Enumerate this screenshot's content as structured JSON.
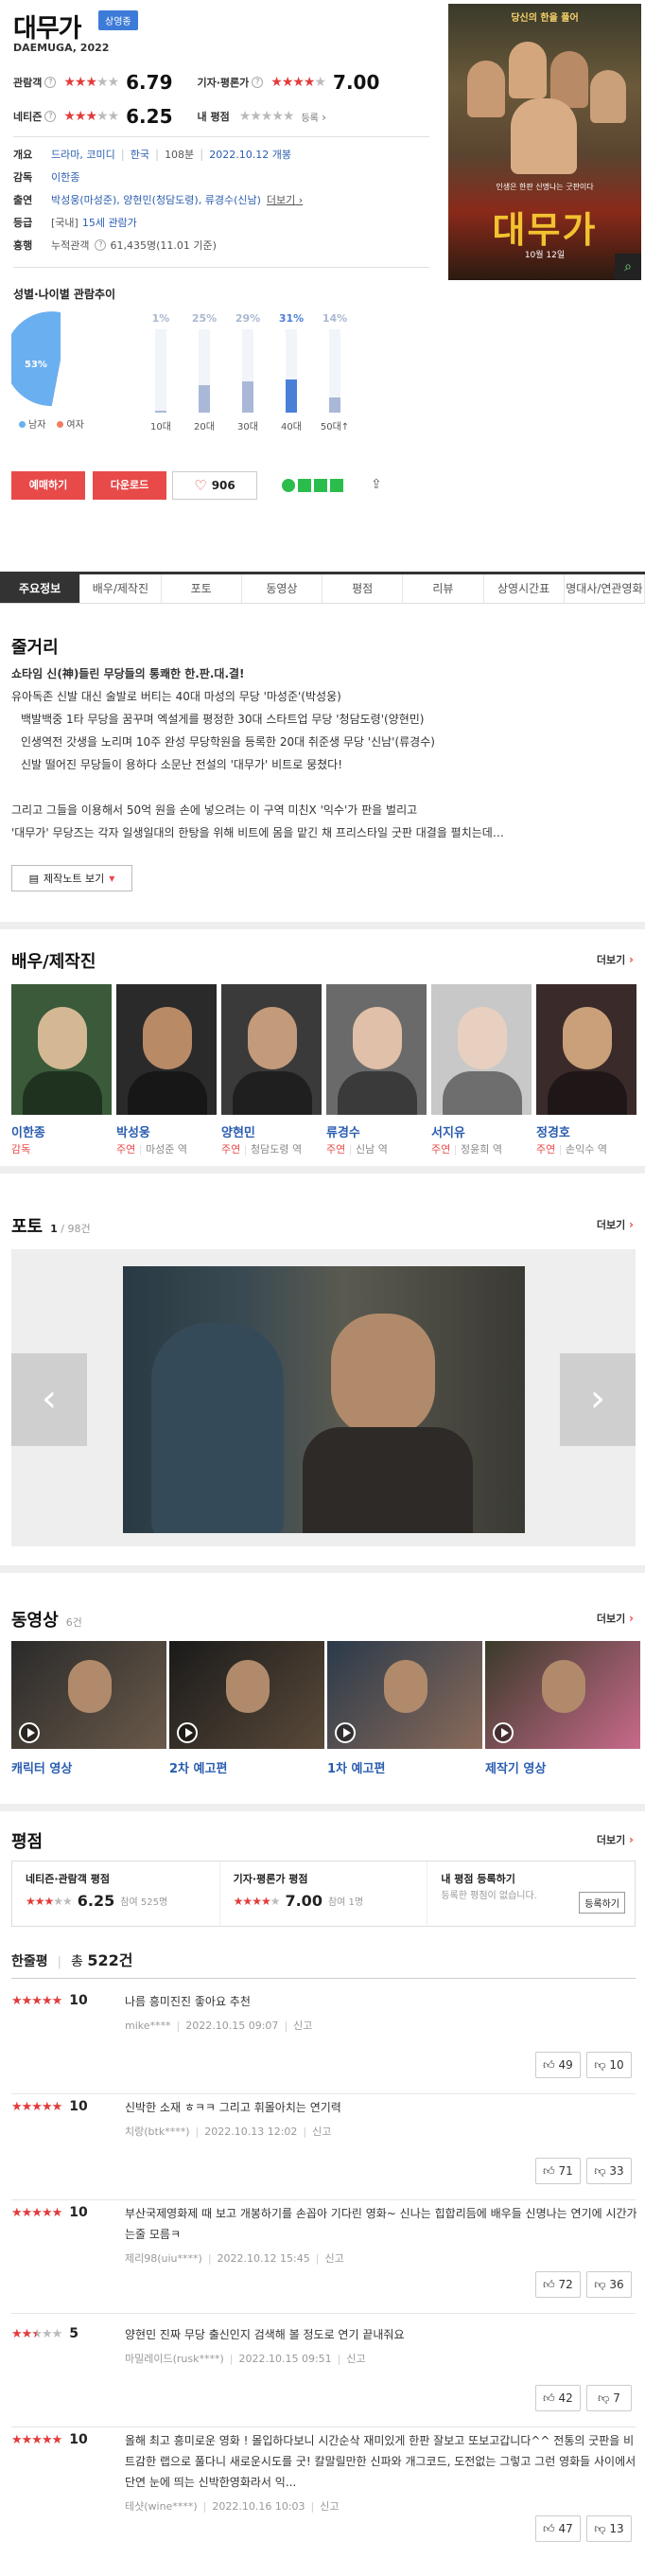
{
  "movie": {
    "title": "대무가",
    "badge": "상영종",
    "subtitle": "DAEMUGA, 2022",
    "audience_label": "관람객",
    "audience_score": "6.79",
    "expert_label": "기자·평론가",
    "expert_score": "7.00",
    "netizen_label": "네티즌",
    "netizen_score": "6.25",
    "my_rating_label": "내 평점",
    "my_rating_link": "등록",
    "overview_label": "개요",
    "genre": "드라마, 코미디",
    "country": "한국",
    "runtime": "108분",
    "release": "2022.10.12 개봉",
    "director_label": "감독",
    "director": "이한종",
    "cast_label": "출연",
    "cast_line": "박성웅(마성준), 양현민(청담도령), 류경수(신남)",
    "cast_more": "더보기",
    "rating_label": "등급",
    "rating_country": "[국내]",
    "rating_value": "15세 관람가",
    "box_label": "흥행",
    "box_text": "누적관객",
    "box_value": "61,435명(11.01 기준)"
  },
  "poster": {
    "tagline1": "당신의 한을 풀어",
    "tagline2": "대무가",
    "small": "인생은 한판 신명나는 굿판이다",
    "release_tag": "10월 12일"
  },
  "demographics": {
    "title": "성별·나이별 관람추이",
    "male_pct": "53%",
    "female_pct": "47%",
    "male_label": "남자",
    "female_label": "여자",
    "male_value": 53,
    "female_value": 47,
    "ages": [
      {
        "label": "10대",
        "pct": "1%",
        "value": 1
      },
      {
        "label": "20대",
        "pct": "25%",
        "value": 25
      },
      {
        "label": "30대",
        "pct": "29%",
        "value": 29
      },
      {
        "label": "40대",
        "pct": "31%",
        "value": 31
      },
      {
        "label": "50대↑",
        "pct": "14%",
        "value": 14
      }
    ]
  },
  "actions": {
    "reserve": "예매하기",
    "download": "다운로드",
    "like_count": "906"
  },
  "tabs": [
    "주요정보",
    "배우/제작진",
    "포토",
    "동영상",
    "평점",
    "리뷰",
    "상영시간표",
    "명대사/연관영화"
  ],
  "plot": {
    "heading": "줄거리",
    "lines": [
      "쇼타임 신(神)들린 무당들의 통쾌한 한.판.대.결!",
      "유아독존 신발 대신 술발로 버티는 40대 마성의 무당 '마성준'(박성웅)",
      "백발백중 1타 무당을 꿈꾸며 엑설게를 평정한 30대 스타트업 무당 '청담도령'(양현민)",
      "인생역전 갓생을 노리며 10주 완성 무당학원을 등록한 20대 취준생 무당 '신남'(류경수)",
      "신발 떨어진 무당들이 용하다 소문난 전설의 '대무가' 비트로 뭉쳤다!",
      "",
      "그리고 그들을 이용해서 50억 원을 손에 넣으려는 이 구역 미친X '익수'가 판을 벌리고",
      "'대무가' 무당즈는 각자 일생일대의 한탕을 위해 비트에 몸을 맡긴 채 프리스타일 굿판 대결을 펼치는데…"
    ],
    "note_button": "제작노트 보기"
  },
  "cast": {
    "heading": "배우/제작진",
    "more": "더보기",
    "people": [
      {
        "name": "이한종",
        "type": "감독",
        "role": ""
      },
      {
        "name": "박성웅",
        "type": "주연",
        "role": "마성준 역"
      },
      {
        "name": "양현민",
        "type": "주연",
        "role": "청담도령 역"
      },
      {
        "name": "류경수",
        "type": "주연",
        "role": "신남 역"
      },
      {
        "name": "서지유",
        "type": "주연",
        "role": "정윤희 역"
      },
      {
        "name": "정경호",
        "type": "주연",
        "role": "손익수 역"
      }
    ]
  },
  "photo": {
    "heading": "포토",
    "count": "1",
    "total": "/ 98건",
    "more": "더보기"
  },
  "video": {
    "heading": "동영상",
    "count": "6건",
    "more": "더보기",
    "items": [
      "캐릭터 영상",
      "2차 예고편",
      "1차 예고편",
      "제작기 영상"
    ]
  },
  "rating": {
    "heading": "평점",
    "more": "더보기",
    "netizen_title": "네티즌·관람객 평점",
    "netizen_score": "6.25",
    "netizen_count": "참여 525명",
    "expert_title": "기자·평론가 평점",
    "expert_score": "7.00",
    "expert_count": "참여 1명",
    "my_title": "내 평점 등록하기",
    "my_desc": "등록한 평점이 없습니다.",
    "my_button": "등록하기"
  },
  "reviews": {
    "heading": "한줄평",
    "total_label": "총",
    "total_count": "522건",
    "items": [
      {
        "score": "10",
        "text": "나름 흥미진진 좋아요 추천",
        "user": "mike****",
        "date": "2022.10.15 09:07",
        "report": "신고",
        "up": "49",
        "down": "10",
        "stars": 5
      },
      {
        "score": "10",
        "text": "신박한 소재 ㅎㅋㅋ 그리고 휘몰아치는 연기력",
        "user": "치랑(btk****)",
        "date": "2022.10.13 12:02",
        "report": "신고",
        "up": "71",
        "down": "33",
        "stars": 5
      },
      {
        "score": "10",
        "text": "부산국제영화제 때 보고 개봉하기를 손꼽아 기다린 영화~ 신나는 힙합리듬에 배우들 신명나는 연기에 시간가는줄 모름ㅋ",
        "user": "제리98(uiu****)",
        "date": "2022.10.12 15:45",
        "report": "신고",
        "up": "72",
        "down": "36",
        "stars": 5
      },
      {
        "score": "5",
        "text": "양현민 진짜 무당 출신인지 검색해 볼 정도로 연기 끝내줘요",
        "user": "마밀레이드(rusk****)",
        "date": "2022.10.15 09:51",
        "report": "신고",
        "up": "42",
        "down": "7",
        "stars": 2.5
      },
      {
        "score": "10",
        "text": "올해 최고 흥미로운 영화 ! 몰입하다보니 시간순삭 재미있게 한판 잘보고 또보고갑니다^^ 전통의 굿판을 비트감한 랩으로 풀다니 새로운시도를 굿! 칼말릴만한 신파와 개그코드, 도전없는 그렇고 그런 영화들 사이에서 단연 눈에 띄는 신박한영화라서 익...",
        "user": "테샷(wine****)",
        "date": "2022.10.16 10:03",
        "report": "신고",
        "up": "47",
        "down": "13",
        "stars": 5
      }
    ]
  }
}
